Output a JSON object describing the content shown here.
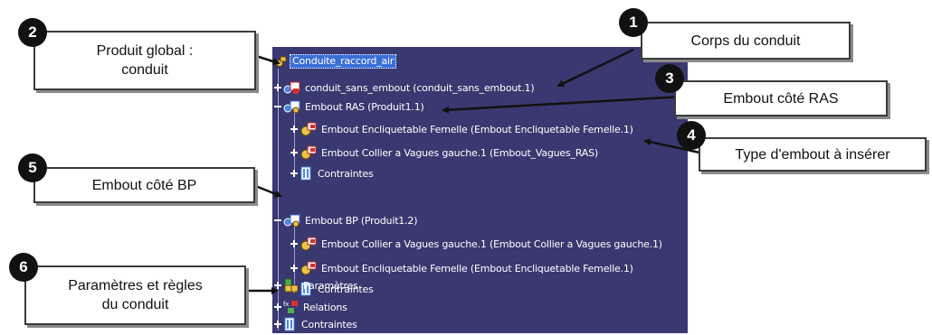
{
  "tree": {
    "root": "Conduite_raccord_air",
    "items": [
      "conduit_sans_embout (conduit_sans_embout.1)",
      "Embout RAS (Produit1.1)",
      "Embout Encliquetable Femelle (Embout Encliquetable Femelle.1)",
      "Embout Collier a Vagues gauche.1 (Embout_Vagues_RAS)",
      "Contraintes",
      "Embout BP (Produit1.2)",
      "Embout Collier a Vagues gauche.1 (Embout Collier a Vagues gauche.1)",
      "Embout Encliquetable Femelle (Embout Encliquetable Femelle.1)",
      "Contraintes",
      "Paramètres",
      "Relations",
      "Contraintes"
    ]
  },
  "callouts": [
    {
      "num": "1",
      "text": "Corps du conduit"
    },
    {
      "num": "2",
      "text": "Produit global :\nconduit"
    },
    {
      "num": "3",
      "text": "Embout côté RAS"
    },
    {
      "num": "4",
      "text": "Type d'embout à insérer"
    },
    {
      "num": "5",
      "text": "Embout côté BP"
    },
    {
      "num": "6",
      "text": "Paramètres et règles\ndu conduit"
    }
  ],
  "colors": {
    "tree_background": "#3a3870",
    "selection": "#3b6fd8",
    "callout_border": "#3b3b3b",
    "badge": "#111111"
  }
}
